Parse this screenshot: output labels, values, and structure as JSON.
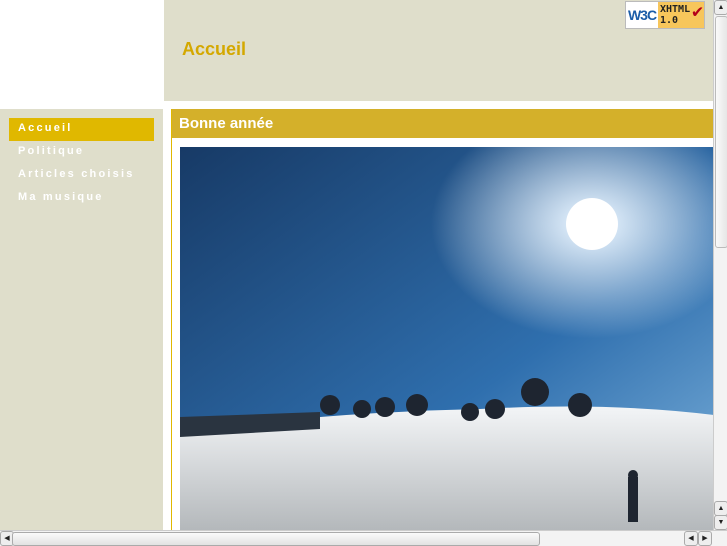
{
  "header": {
    "title": "Accueil",
    "badge": {
      "w3c": "W3C",
      "label_line1": "XHTML",
      "label_line2": "1.0"
    }
  },
  "sidebar": {
    "items": [
      {
        "label": "Accueil",
        "active": true
      },
      {
        "label": "Politique"
      },
      {
        "label": "Articles choisis"
      },
      {
        "label": "Ma musique"
      }
    ]
  },
  "main": {
    "title": "Bonne année"
  },
  "colors": {
    "accent": "#d4b02a",
    "active": "#e0b800",
    "panel": "#dfdecb"
  }
}
